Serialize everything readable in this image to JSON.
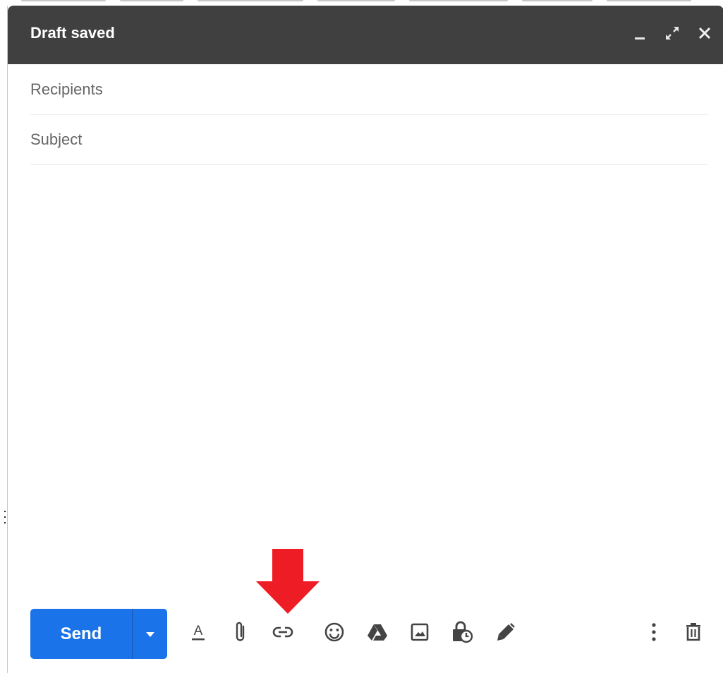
{
  "compose": {
    "title": "Draft saved",
    "minimize_icon": "minimize-icon",
    "fullscreen_icon": "expand-icon",
    "close_icon": "close-icon",
    "recipients_placeholder": "Recipients",
    "subject_placeholder": "Subject",
    "body_value": ""
  },
  "footer": {
    "send_label": "Send",
    "send_options_icon": "caret-down-icon",
    "tools": [
      {
        "name": "formatting-options-icon"
      },
      {
        "name": "attach-files-icon"
      },
      {
        "name": "insert-link-icon"
      },
      {
        "name": "insert-emoji-icon"
      },
      {
        "name": "insert-drive-icon"
      },
      {
        "name": "insert-photo-icon"
      },
      {
        "name": "confidential-mode-icon"
      },
      {
        "name": "insert-signature-icon"
      },
      {
        "name": "more-options-icon"
      },
      {
        "name": "discard-draft-icon"
      }
    ]
  },
  "annotation": {
    "highlight_target": "insert-link-icon",
    "arrow_color": "#ee1c25"
  },
  "colors": {
    "titlebar_bg": "#404040",
    "send_button_bg": "#1a73e8",
    "icon_color": "#444444"
  }
}
